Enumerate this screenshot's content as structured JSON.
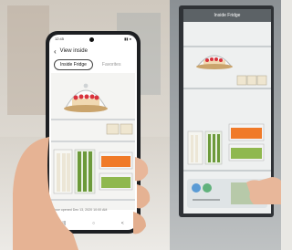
{
  "phone": {
    "status_time": "12:45",
    "status_icons": "▮▮ ●",
    "nav_title": "View inside",
    "tabs": [
      {
        "label": "Inside Fridge",
        "active": true
      },
      {
        "label": "Favorites",
        "active": false
      }
    ],
    "caption": "Door opened Dec 13, 2020 10:00 AM",
    "nav_buttons": [
      "|||",
      "○",
      "<"
    ]
  },
  "fridge": {
    "screen_title": "Inside Fridge"
  },
  "colors": {
    "phone_body": "#1d1f22",
    "fridge_body": "#2f3236",
    "strawberry": "#d8323c",
    "carrot": "#f07a28",
    "asparagus": "#6c9a3a"
  }
}
